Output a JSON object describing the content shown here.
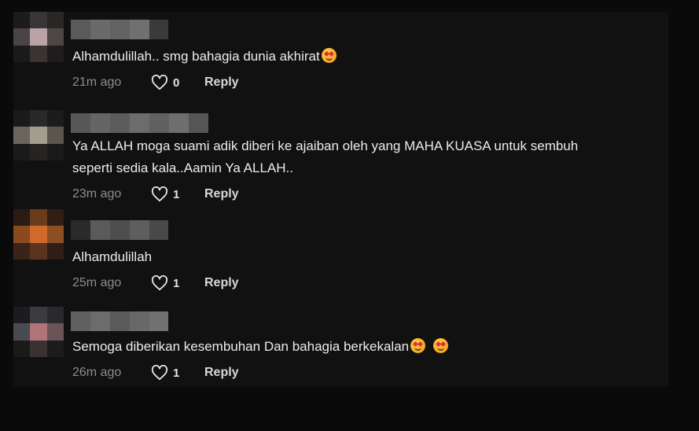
{
  "comments": [
    {
      "text": "Alhamdulillah.. smg bahagia dunia akhirat",
      "emoji": "smiling-face-with-heart-eyes-icon",
      "time": "21m ago",
      "likes": "0",
      "reply_label": "Reply"
    },
    {
      "text_line1": "Ya ALLAH moga suami adik diberi ke ajaiban oleh yang MAHA KUASA untuk sembuh",
      "text_line2": "seperti sedia kala..Aamin Ya ALLAH..",
      "time": "23m ago",
      "likes": "1",
      "reply_label": "Reply"
    },
    {
      "text": "Alhamdulillah",
      "time": "25m ago",
      "likes": "1",
      "reply_label": "Reply"
    },
    {
      "text": "Semoga diberikan kesembuhan Dan bahagia berkekalan",
      "emoji": "smiling-face-with-heart-eyes-icon",
      "time": "26m ago",
      "likes": "1",
      "reply_label": "Reply"
    }
  ],
  "colors": {
    "background": "#0a0a0a",
    "panel": "#111111",
    "text": "#ececec",
    "muted": "#8d8d8d"
  }
}
